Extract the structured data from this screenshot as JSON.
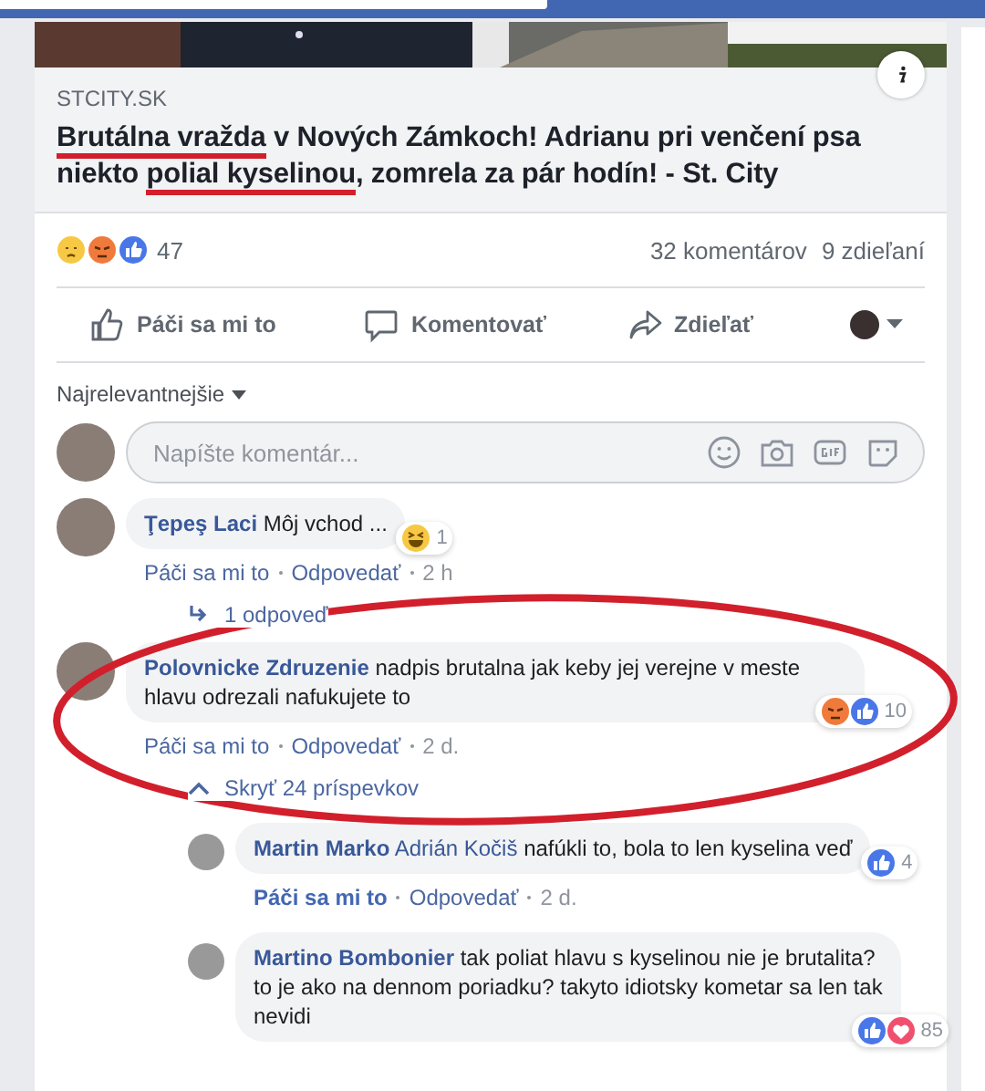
{
  "link_preview": {
    "kind": "picture",
    "domain": "STCITY.SK",
    "headline": [
      {
        "text": "Brutálna vražda",
        "marked": true
      },
      {
        "text": " v Nových Zámkoch! Adrianu pri venčení psa niekto ",
        "marked": false
      },
      {
        "text": "polial kyselinou",
        "marked": true
      },
      {
        "text": ", zomrela za pár hodín! - St. City",
        "marked": false
      }
    ]
  },
  "stats": {
    "reactions": [
      {
        "kind": "sad"
      },
      {
        "kind": "angry"
      },
      {
        "kind": "like"
      }
    ],
    "reaction_count": "47",
    "comments": "32 komentárov",
    "shares": "9 zdieľaní"
  },
  "actions": [
    {
      "kind": "like",
      "label": "Páči sa mi to"
    },
    {
      "kind": "comment",
      "label": "Komentovať"
    },
    {
      "kind": "share",
      "label": "Zdieľať"
    }
  ],
  "sort": "Najrelevantnejšie",
  "comment_input": {
    "placeholder": "Napíšte komentár..."
  },
  "comments": [
    {
      "author": "Ţepeş Laci",
      "text": "Môj vchod ...",
      "reactions": [
        {
          "kind": "haha"
        }
      ],
      "reaction_count": "1",
      "like": "Páči sa mi to",
      "reply": "Odpovedať",
      "time": "2 h",
      "liked": false,
      "replies_link": {
        "kind": "collapsed",
        "text": "1 odpoveď"
      }
    },
    {
      "author": "Polovnicke Zdruzenie",
      "text": "nadpis brutalna jak keby jej verejne v meste hlavu odrezali nafukujete to",
      "reactions": [
        {
          "kind": "angry"
        },
        {
          "kind": "like"
        }
      ],
      "reaction_count": "10",
      "like": "Páči sa mi to",
      "reply": "Odpovedať",
      "time": "2 d.",
      "liked": false,
      "replies_link": {
        "kind": "expanded",
        "text": "Skryť 24 príspevkov"
      },
      "children": [
        {
          "author": "Martin Marko",
          "mention": "Adrián Kočiš",
          "text": "nafúkli to, bola to len kyselina veď",
          "reactions": [
            {
              "kind": "like"
            }
          ],
          "reaction_count": "4",
          "like": "Páči sa mi to",
          "reply": "Odpovedať",
          "time": "2 d.",
          "liked": true
        },
        {
          "author": "Martino Bombonier",
          "text": "tak poliat hlavu s kyselinou nie je brutalita? to je ako na dennom poriadku? takyto idiotsky kometar sa len tak nevidi",
          "reactions": [
            {
              "kind": "like"
            },
            {
              "kind": "love"
            }
          ],
          "reaction_count": "85"
        }
      ]
    }
  ]
}
